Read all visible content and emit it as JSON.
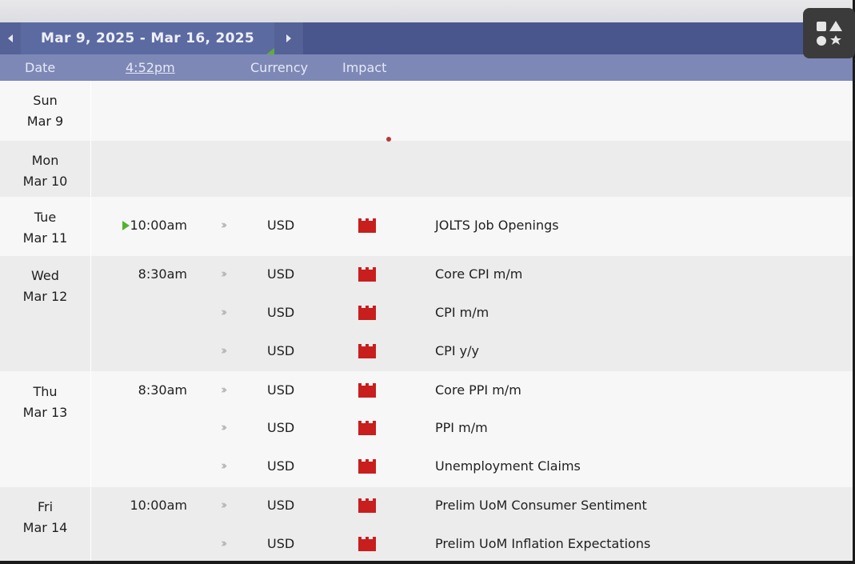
{
  "nav": {
    "range": "Mar 9, 2025 - Mar 16, 2025"
  },
  "header": {
    "date": "Date",
    "time": "4:52pm",
    "currency": "Currency",
    "impact": "Impact"
  },
  "impact_color": "#c81e1e",
  "days": [
    {
      "dow": "Sun",
      "date": "Mar 9",
      "events": []
    },
    {
      "dow": "Mon",
      "date": "Mar 10",
      "events": []
    },
    {
      "dow": "Tue",
      "date": "Mar 11",
      "events": [
        {
          "time": "10:00am",
          "currency": "USD",
          "impact": "high",
          "name": "JOLTS Job Openings"
        }
      ]
    },
    {
      "dow": "Wed",
      "date": "Mar 12",
      "events": [
        {
          "time": "8:30am",
          "currency": "USD",
          "impact": "high",
          "name": "Core CPI m/m"
        },
        {
          "time": "",
          "currency": "USD",
          "impact": "high",
          "name": "CPI m/m"
        },
        {
          "time": "",
          "currency": "USD",
          "impact": "high",
          "name": "CPI y/y"
        }
      ]
    },
    {
      "dow": "Thu",
      "date": "Mar 13",
      "events": [
        {
          "time": "8:30am",
          "currency": "USD",
          "impact": "high",
          "name": "Core PPI m/m"
        },
        {
          "time": "",
          "currency": "USD",
          "impact": "high",
          "name": "PPI m/m"
        },
        {
          "time": "",
          "currency": "USD",
          "impact": "high",
          "name": "Unemployment Claims"
        }
      ]
    },
    {
      "dow": "Fri",
      "date": "Mar 14",
      "events": [
        {
          "time": "10:00am",
          "currency": "USD",
          "impact": "high",
          "name": "Prelim UoM Consumer Sentiment"
        },
        {
          "time": "",
          "currency": "USD",
          "impact": "high",
          "name": "Prelim UoM Inflation Expectations"
        }
      ]
    }
  ]
}
